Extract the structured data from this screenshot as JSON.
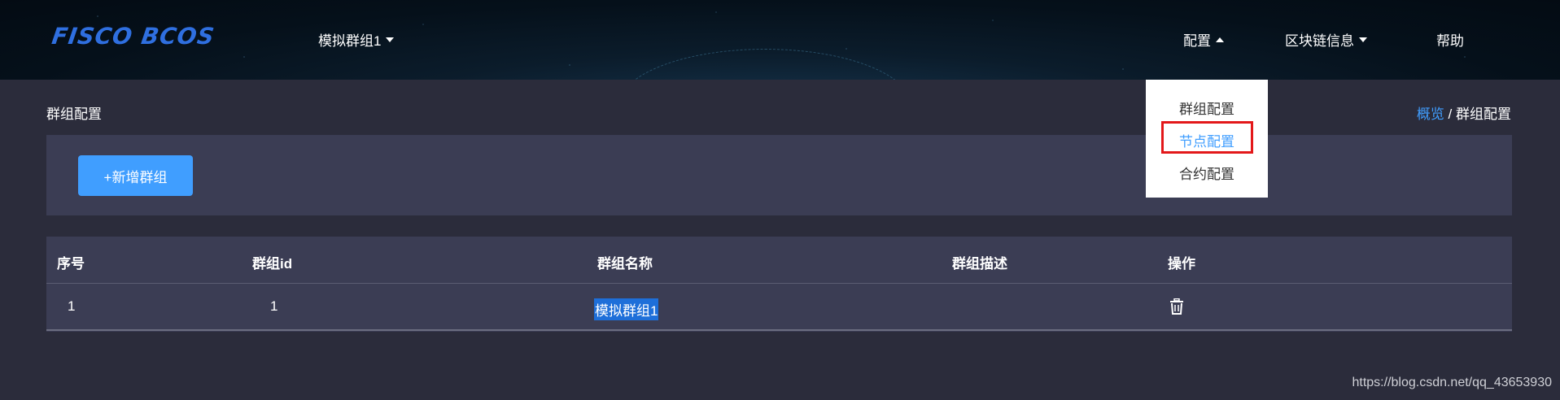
{
  "header": {
    "logo": "FISCO BCOS",
    "group_selector": "模拟群组1",
    "nav": {
      "config": "配置",
      "chain_info": "区块链信息",
      "help": "帮助"
    }
  },
  "page": {
    "title": "群组配置",
    "breadcrumb": {
      "home": "概览",
      "separator": " / ",
      "current": "群组配置"
    }
  },
  "toolbar": {
    "add_group_label": "+新增群组"
  },
  "table": {
    "columns": [
      "序号",
      "群组id",
      "群组名称",
      "群组描述",
      "操作"
    ],
    "rows": [
      {
        "index": "1",
        "group_id": "1",
        "name": "模拟群组1",
        "description": ""
      }
    ]
  },
  "config_menu": {
    "items": [
      "群组配置",
      "节点配置",
      "合约配置"
    ],
    "active_index": 1
  },
  "watermark": "https://blog.csdn.net/qq_43653930",
  "colors": {
    "accent": "#409eff",
    "background": "#2b2c3b",
    "panel": "#3b3d54",
    "highlight_box": "#e3181a"
  },
  "icons": {
    "group_caret": "chevron-down-icon",
    "config_caret": "chevron-up-icon",
    "chain_caret": "chevron-down-icon",
    "row_action": "trash-icon"
  }
}
